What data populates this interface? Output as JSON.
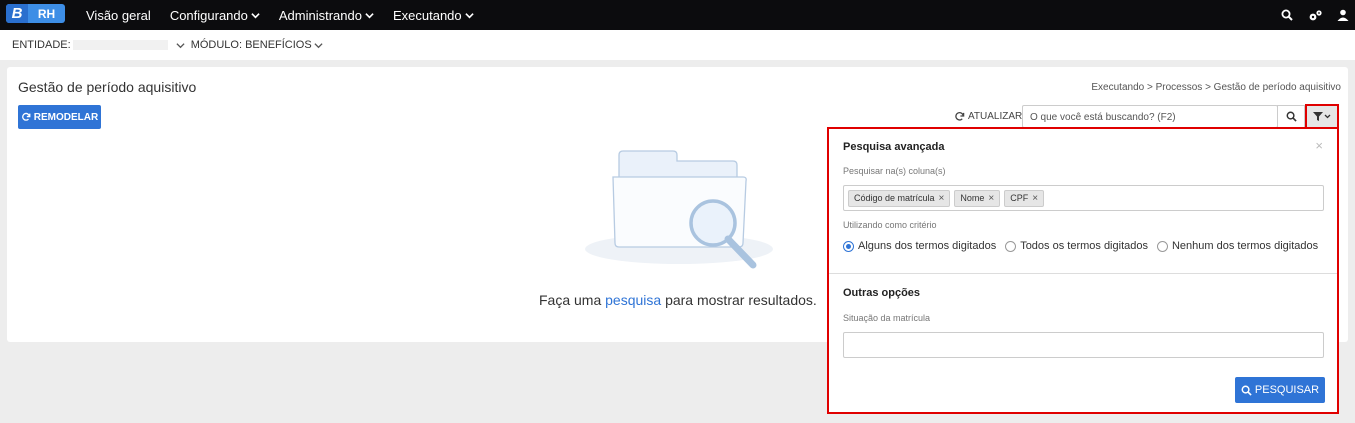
{
  "app": {
    "logo_letter": "B",
    "logo_text": "RH"
  },
  "nav": {
    "items": [
      {
        "label": "Visão geral"
      },
      {
        "label": "Configurando"
      },
      {
        "label": "Administrando"
      },
      {
        "label": "Executando"
      }
    ]
  },
  "entity_bar": {
    "entity_label": "ENTIDADE:",
    "module_label": "MÓDULO: BENEFÍCIOS"
  },
  "page": {
    "title": "Gestão de período aquisitivo",
    "breadcrumb": "Executando > Processos > Gestão de período aquisitivo",
    "remodel_label": "REMODELAR",
    "refresh_label": "ATUALIZAR",
    "search_placeholder": "O que você está buscando? (F2)",
    "empty_prefix": "Faça uma ",
    "empty_link": "pesquisa",
    "empty_suffix": " para mostrar resultados."
  },
  "advanced_search": {
    "title": "Pesquisa avançada",
    "columns_label": "Pesquisar na(s) coluna(s)",
    "chips": [
      "Código de matrícula",
      "Nome",
      "CPF"
    ],
    "criteria_label": "Utilizando como critério",
    "criteria_options": [
      "Alguns dos termos digitados",
      "Todos os termos digitados",
      "Nenhum dos termos digitados"
    ],
    "selected_criteria": "Alguns dos termos digitados",
    "other_title": "Outras opções",
    "situation_label": "Situação da matrícula",
    "situation_value": "",
    "search_button": "PESQUISAR"
  },
  "colors": {
    "accent": "#2f74d6",
    "highlight": "#e00000",
    "navbar": "#0c0c0e"
  }
}
